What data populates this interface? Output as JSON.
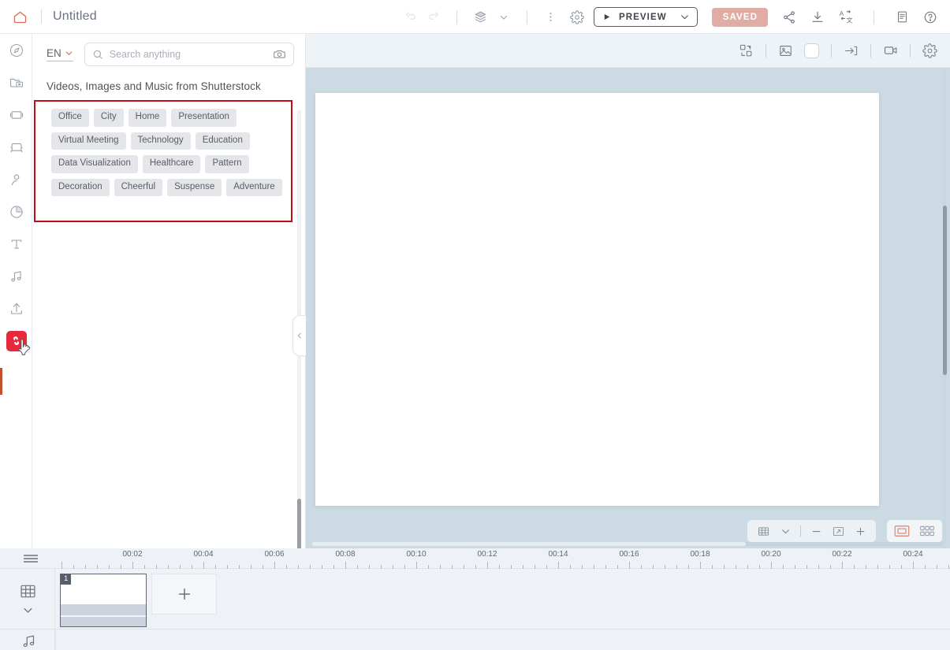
{
  "topbar": {
    "home_icon": "home-icon",
    "doc_title": "Untitled",
    "undo_icon": "undo-icon",
    "redo_icon": "redo-icon",
    "layers_icon": "layers-icon",
    "layers_chevron_icon": "chevron-down-icon",
    "more_icon": "more-vertical-icon",
    "settings_icon": "gear-icon",
    "preview_label": "PREVIEW",
    "preview_play_icon": "play-icon",
    "preview_chevron_icon": "chevron-down-icon",
    "saved_label": "SAVED",
    "share_icon": "share-icon",
    "download_icon": "download-icon",
    "translate_icon": "translate-icon",
    "notes_icon": "notes-icon",
    "help_icon": "help-circle-icon",
    "accent_red": "#e7293c",
    "saved_color": "#e0aca4"
  },
  "rail": {
    "items": [
      {
        "name": "discover",
        "icon": "compass-icon"
      },
      {
        "name": "projects",
        "icon": "folder-video-icon"
      },
      {
        "name": "scenes",
        "icon": "slide-frames-icon"
      },
      {
        "name": "props",
        "icon": "sofa-icon"
      },
      {
        "name": "characters",
        "icon": "person-icon"
      },
      {
        "name": "charts",
        "icon": "pie-chart-icon"
      },
      {
        "name": "text",
        "icon": "text-t-icon"
      },
      {
        "name": "music",
        "icon": "music-note-icon"
      },
      {
        "name": "upload",
        "icon": "upload-icon"
      },
      {
        "name": "shutterstock",
        "icon": "shutterstock-icon",
        "active": true
      }
    ]
  },
  "panel": {
    "language": "EN",
    "language_chevron_icon": "chevron-down-icon",
    "search_icon": "search-icon",
    "search_value": "",
    "search_placeholder": "Search anything",
    "camera_icon": "camera-icon",
    "heading": "Videos, Images and Music from Shutterstock",
    "collapse_icon": "chevron-left-icon",
    "highlight_color": "#c10d17",
    "tags": [
      "Office",
      "City",
      "Home",
      "Presentation",
      "Virtual Meeting",
      "Technology",
      "Education",
      "Data Visualization",
      "Healthcare",
      "Pattern",
      "Decoration",
      "Cheerful",
      "Suspense",
      "Adventure"
    ]
  },
  "stage": {
    "toolbar": [
      {
        "name": "swap-scene",
        "icon": "swap-icon"
      },
      {
        "name": "background-image",
        "icon": "image-icon"
      },
      {
        "name": "background-color",
        "icon": "color-swatch-icon"
      },
      {
        "name": "transition",
        "icon": "arrow-into-bracket-icon"
      },
      {
        "name": "record-video",
        "icon": "video-camera-icon"
      },
      {
        "name": "scene-settings",
        "icon": "gear-icon"
      }
    ],
    "zoom_controls": [
      {
        "name": "grid-toggle",
        "icon": "grid-icon"
      },
      {
        "name": "grid-options",
        "icon": "chevron-down-icon"
      },
      {
        "name": "zoom-out",
        "icon": "minus-icon"
      },
      {
        "name": "fit-to-screen",
        "icon": "fit-screen-icon"
      },
      {
        "name": "zoom-in",
        "icon": "plus-icon"
      }
    ],
    "view_controls": [
      {
        "name": "single-view",
        "icon": "single-slide-icon",
        "active": true
      },
      {
        "name": "grid-view",
        "icon": "grid-slides-icon"
      }
    ],
    "active_view_color": "#d9806c"
  },
  "timeline": {
    "drag_handle_icon": "drag-handle-icon",
    "scenes_icon": "film-grid-icon",
    "scenes_chevron_icon": "chevron-down-icon",
    "audio_icon": "music-note-icon",
    "add_slide_icon": "plus-icon",
    "slides": [
      {
        "number": "1"
      }
    ],
    "time_labels": [
      "00:02",
      "00:04",
      "00:06",
      "00:08",
      "00:10",
      "00:12",
      "00:14",
      "00:16",
      "00:18",
      "00:20",
      "00:22",
      "00:24"
    ],
    "tick_spacing_px": 90,
    "first_label_x": 168
  }
}
